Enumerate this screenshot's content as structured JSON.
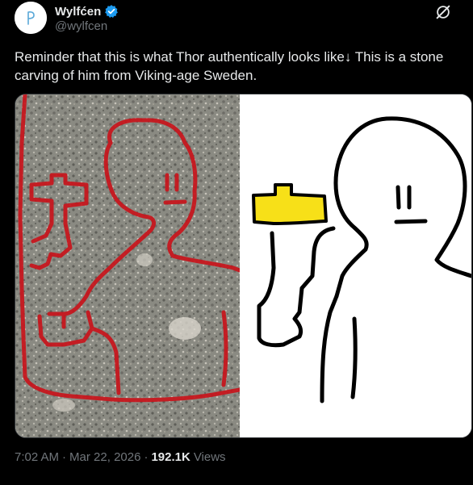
{
  "author": {
    "display_name": "Wylfćen",
    "handle": "@wylfcen",
    "verified": true,
    "avatar_icon": "avatar-letter-icon"
  },
  "icons": {
    "verified": "verified-badge-icon",
    "grok": "grok-icon"
  },
  "tweet": {
    "text": "Reminder that this is what Thor authentically looks like↓ This is a stone carving of him from Viking-age Sweden."
  },
  "meta": {
    "time": "7:02 AM",
    "separator_1": "·",
    "date": "Mar 22, 2026",
    "separator_2": "·",
    "views_count": "192.1K",
    "views_label": "Views"
  },
  "colors": {
    "background": "#000000",
    "text_primary": "#e7e9ea",
    "text_secondary": "#71767b",
    "verified_blue": "#1d9bf0",
    "carving_red": "#c8141c",
    "hammer_yellow": "#f7e018"
  }
}
